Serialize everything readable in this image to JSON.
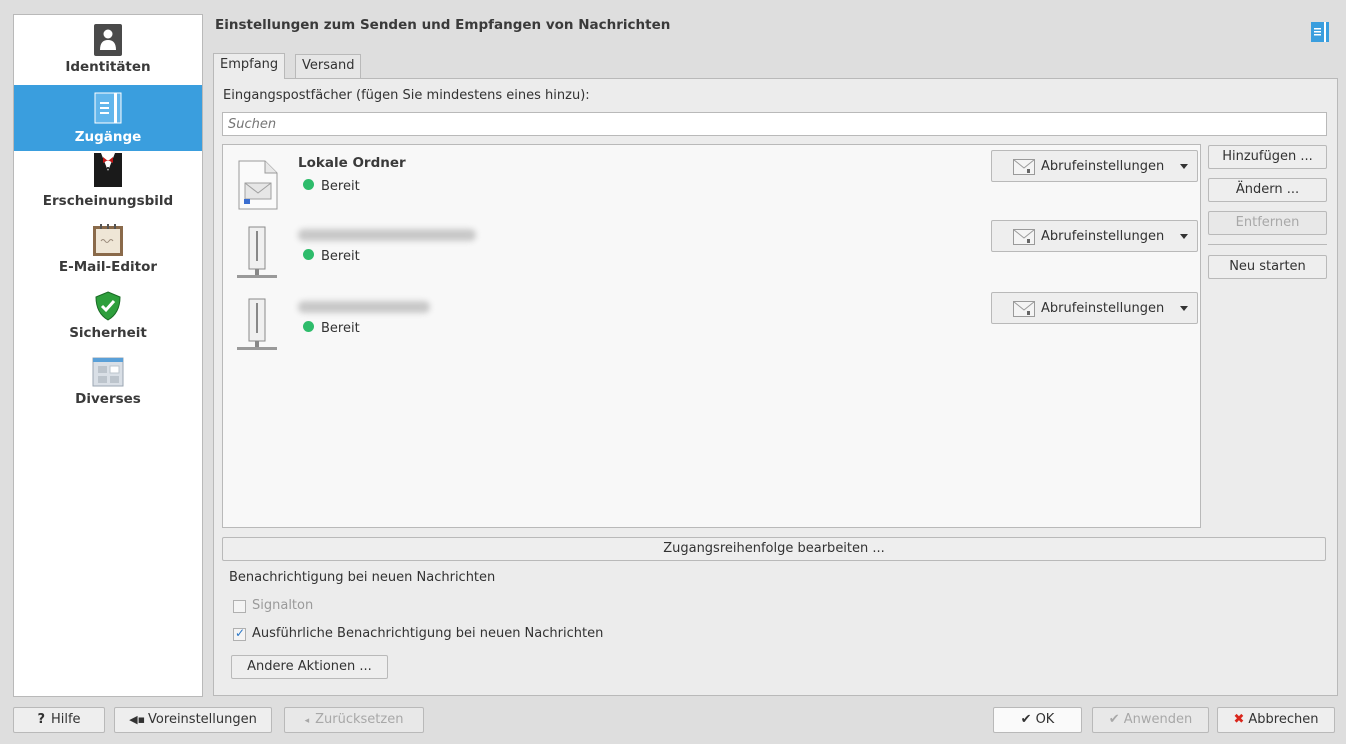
{
  "sidebar": {
    "items": [
      {
        "label": "Identitäten",
        "icon": "identity-icon"
      },
      {
        "label": "Zugänge",
        "icon": "accounts-icon"
      },
      {
        "label": "Erscheinungsbild",
        "icon": "appearance-icon"
      },
      {
        "label": "E-Mail-Editor",
        "icon": "composer-icon"
      },
      {
        "label": "Sicherheit",
        "icon": "security-shield-icon"
      },
      {
        "label": "Diverses",
        "icon": "misc-icon"
      }
    ],
    "active_color": "#3a9ede"
  },
  "header": {
    "title": "Einstellungen zum Senden und Empfangen von Nachrichten"
  },
  "tabs": [
    {
      "label": "Empfang"
    },
    {
      "label": "Versand"
    }
  ],
  "receiving": {
    "inbox_label": "Eingangspostfächer (fügen Sie mindestens eines hinzu):",
    "search_placeholder": "Suchen",
    "accounts": [
      {
        "name": "Lokale Ordner",
        "status": "Bereit",
        "retrieval_label": "Abrufeinstellungen"
      },
      {
        "name": "",
        "status": "Bereit",
        "retrieval_label": "Abrufeinstellungen"
      },
      {
        "name": "",
        "status": "Bereit",
        "retrieval_label": "Abrufeinstellungen"
      }
    ],
    "status_color": "#2ebc6b",
    "buttons": {
      "add": "Hinzufügen ...",
      "modify": "Ändern ...",
      "remove": "Entfernen",
      "restart": "Neu starten"
    },
    "order_button": "Zugangsreihenfolge bearbeiten ...",
    "notification": {
      "section_label": "Benachrichtigung bei neuen Nachrichten",
      "beep_label": "Signalton",
      "beep_checked": false,
      "detailed_label": "Ausführliche Benachrichtigung bei neuen Nachrichten",
      "detailed_checked": true,
      "other_actions": "Andere Aktionen ..."
    }
  },
  "footer": {
    "help": "Hilfe",
    "defaults": "Voreinstellungen",
    "reset": "Zurücksetzen",
    "ok": "OK",
    "apply": "Anwenden",
    "cancel": "Abbrechen",
    "cancel_color": "#d9261c"
  }
}
